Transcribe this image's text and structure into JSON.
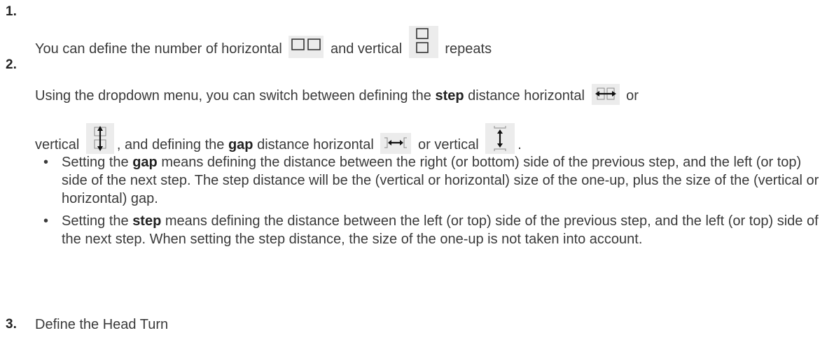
{
  "steps": [
    {
      "number": "1.",
      "text_a": "You can define the number of horizontal",
      "text_b": "and vertical",
      "text_c": "repeats"
    },
    {
      "number": "2.",
      "line1_a": "Using the dropdown menu, you can switch between defining the",
      "line1_bold": "step",
      "line1_b": "distance horizontal",
      "line1_c": "or",
      "line2_a": "vertical",
      "line2_b": ", and defining the",
      "line2_bold": "gap",
      "line2_c": "distance horizontal",
      "line2_d": "or vertical",
      "line2_e": "."
    },
    {
      "number": "3.",
      "text": "Define the Head Turn"
    }
  ],
  "bullets": [
    {
      "pre": "Setting the",
      "bold": "gap",
      "post": "means defining the distance between the right (or bottom) side of the previous step, and the left (or top) side of the next step. The step distance will be the (vertical or horizontal) size of the one-up, plus the size of the (vertical or horizontal) gap."
    },
    {
      "pre": "Setting the",
      "bold": "step",
      "post": "means defining the distance between the left (or top) side of the previous step, and the left (or top) side of the next step. When setting the step distance, the size of the one-up is not taken into account."
    }
  ],
  "icons": [
    "horizontal-repeat-icon",
    "vertical-repeat-icon",
    "horizontal-step-icon",
    "vertical-step-icon",
    "horizontal-gap-icon",
    "vertical-gap-icon"
  ]
}
